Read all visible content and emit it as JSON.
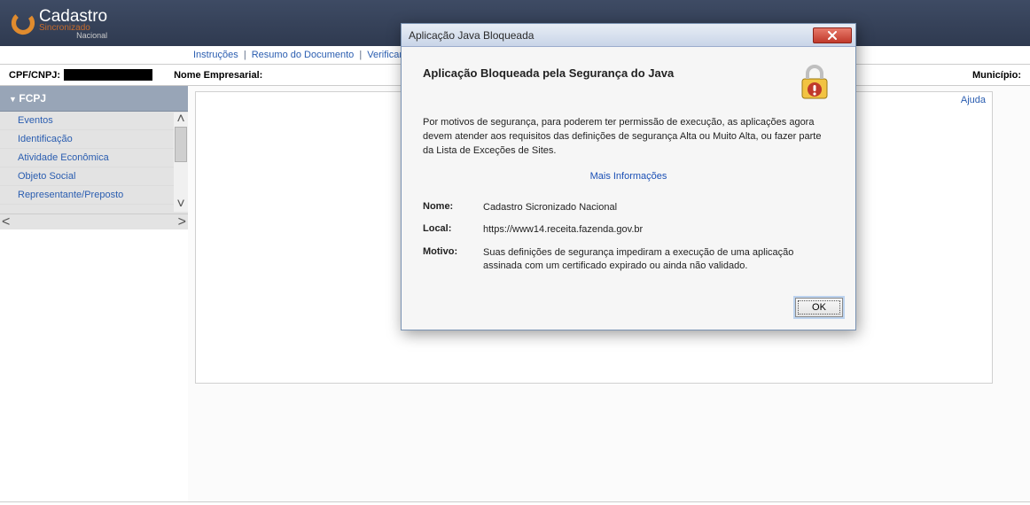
{
  "header": {
    "logo_main": "Cadastro",
    "logo_sub": "Sincronizado",
    "logo_sub2": "Nacional"
  },
  "crumbs": {
    "items": [
      "Instruções",
      "Resumo do Documento",
      "Verificar"
    ]
  },
  "info_row": {
    "cpf_label": "CPF/CNPJ:",
    "nome_label": "Nome Empresarial:",
    "municipio_label": "Município:"
  },
  "sidebar": {
    "title": "FCPJ",
    "items": [
      "Eventos",
      "Identificação",
      "Atividade Econômica",
      "Objeto Social",
      "Representante/Preposto"
    ]
  },
  "main": {
    "ajuda_label": "Ajuda"
  },
  "modal": {
    "title": "Aplicação Java Bloqueada",
    "heading": "Aplicação Bloqueada pela Segurança do Java",
    "paragraph": "Por motivos de segurança, para poderem ter permissão de execução, as aplicações agora devem atender aos requisitos das definições de segurança Alta ou Muito Alta, ou fazer parte da Lista de Exceções de Sites.",
    "more_info": "Mais Informações",
    "nome_label": "Nome:",
    "nome_value": "Cadastro Sicronizado Nacional",
    "local_label": "Local:",
    "local_value": "https://www14.receita.fazenda.gov.br",
    "motivo_label": "Motivo:",
    "motivo_value": "Suas definições de segurança impediram a execução de uma aplicação assinada com um certificado expirado ou ainda não validado.",
    "ok_label": "OK"
  }
}
